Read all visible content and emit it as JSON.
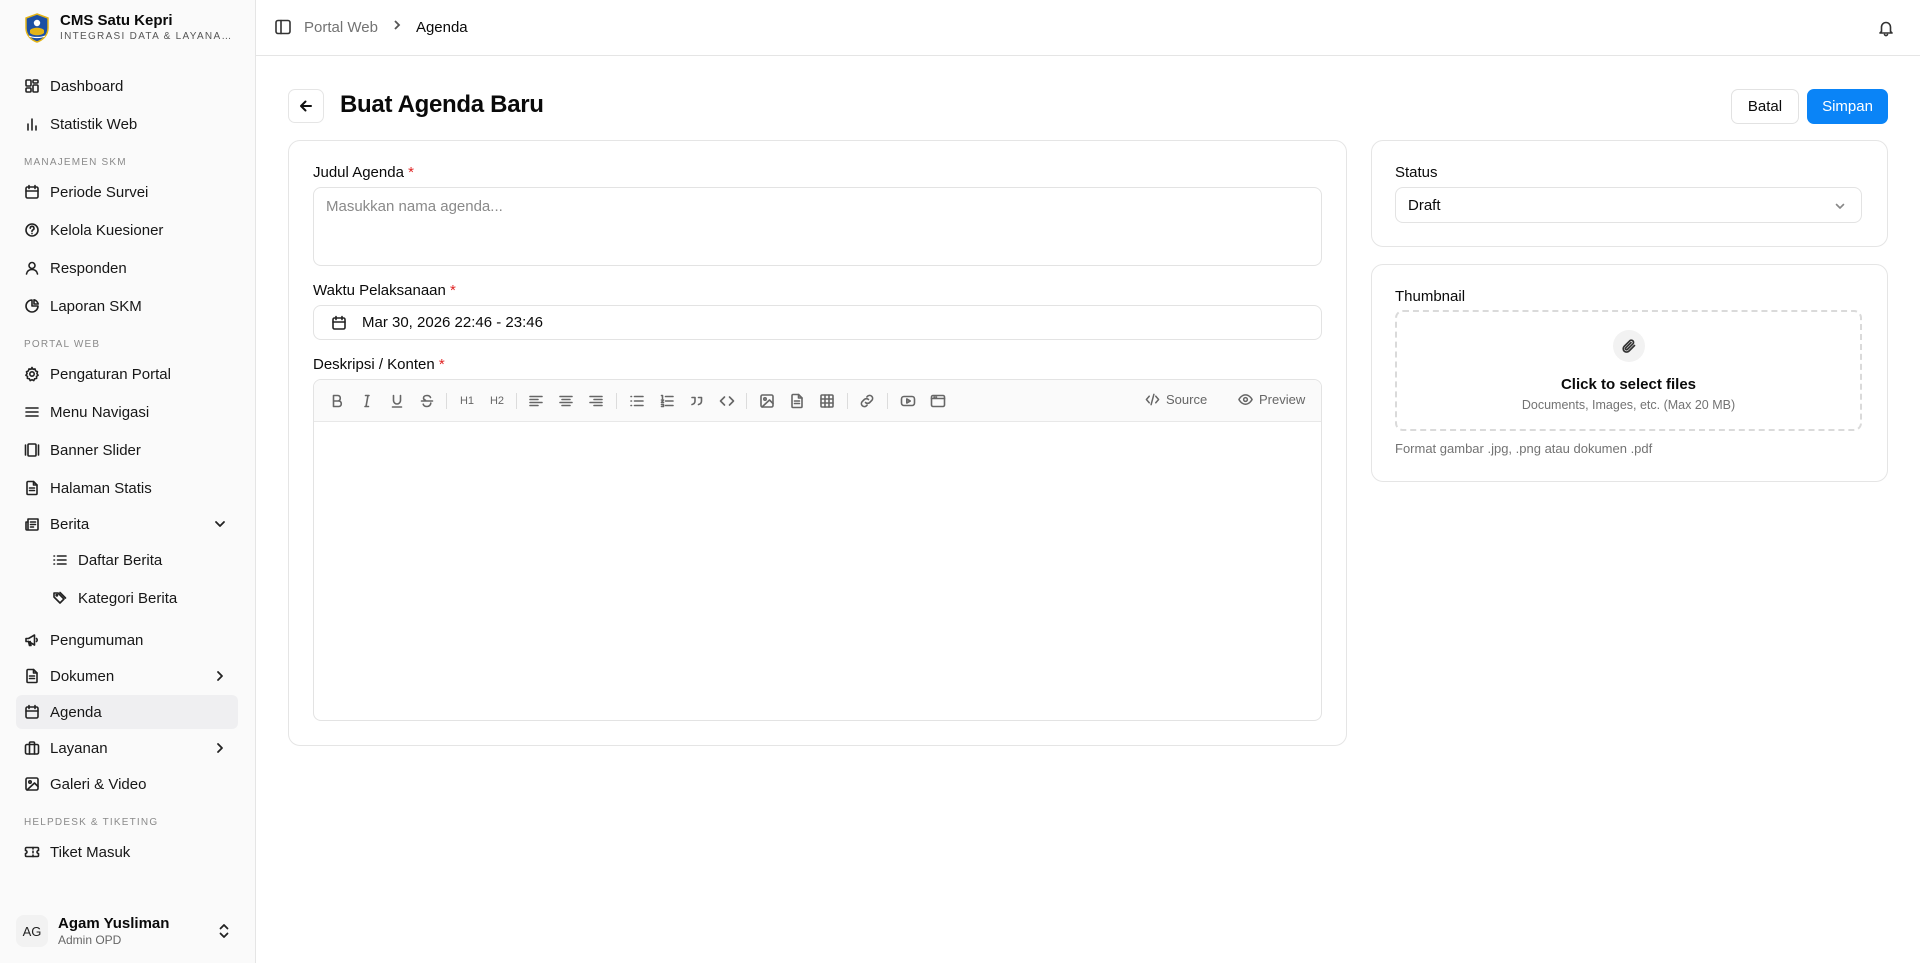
{
  "sidebar": {
    "brand": {
      "title": "CMS Satu Kepri",
      "subtitle": "INTEGRASI DATA & LAYANAN PUBLIK"
    },
    "items": [
      {
        "label": "Dashboard"
      },
      {
        "label": "Statistik Web"
      },
      {
        "label": "Periode Survei"
      },
      {
        "label": "Kelola Kuesioner"
      },
      {
        "label": "Responden"
      },
      {
        "label": "Laporan SKM"
      },
      {
        "label": "Pengaturan Portal"
      },
      {
        "label": "Menu Navigasi"
      },
      {
        "label": "Banner Slider"
      },
      {
        "label": "Halaman Statis"
      },
      {
        "label": "Berita"
      },
      {
        "label": "Daftar Berita"
      },
      {
        "label": "Kategori Berita"
      },
      {
        "label": "Pengumuman"
      },
      {
        "label": "Dokumen"
      },
      {
        "label": "Agenda",
        "active": true
      },
      {
        "label": "Layanan"
      },
      {
        "label": "Galeri & Video"
      },
      {
        "label": "Tiket Masuk"
      }
    ],
    "sections": {
      "skm": "MANAJEMEN SKM",
      "portal": "PORTAL WEB",
      "helpdesk": "HELPDESK & TIKETING"
    },
    "user": {
      "initials": "AG",
      "name": "Agam Yusliman",
      "role": "Admin OPD"
    }
  },
  "header": {
    "breadcrumb": {
      "parent": "Portal Web",
      "current": "Agenda"
    }
  },
  "page": {
    "title": "Buat Agenda Baru",
    "cancel_label": "Batal",
    "save_label": "Simpan"
  },
  "form": {
    "title_label": "Judul Agenda",
    "required_mark": "*",
    "title_placeholder": "Masukkan nama agenda...",
    "time_label": "Waktu Pelaksanaan",
    "time_value": "Mar 30, 2026 22:46 - 23:46",
    "desc_label": "Deskripsi / Konten",
    "toolbar": {
      "h1": "H1",
      "h2": "H2",
      "source": "Source",
      "preview": "Preview"
    }
  },
  "side": {
    "status_label": "Status",
    "status_value": "Draft",
    "thumbnail_label": "Thumbnail",
    "dropzone_title": "Click to select files",
    "dropzone_sub": "Documents, Images, etc. (Max 20 MB)",
    "format_hint": "Format gambar .jpg, .png atau dokumen .pdf"
  },
  "colors": {
    "accent": "#0a84f7",
    "required": "#e02424",
    "active_bg": "#efeff1"
  }
}
